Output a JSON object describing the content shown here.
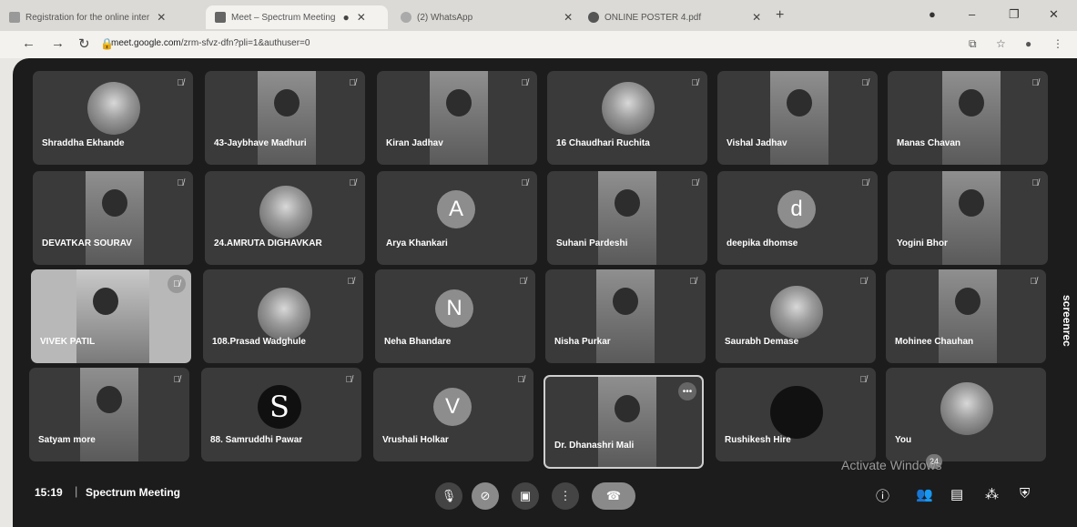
{
  "browser": {
    "tabs": [
      {
        "title": "Registration for the online inter",
        "active": false
      },
      {
        "title": "Meet – Spectrum Meeting",
        "active": true
      },
      {
        "title": "(2) WhatsApp",
        "active": false
      },
      {
        "title": "ONLINE POSTER 4.pdf",
        "active": false
      }
    ],
    "url_host": "meet.google.com",
    "url_path": "/zrm-sfvz-dfn?pli=1&authuser=0"
  },
  "participants": [
    {
      "name": "Shraddha Ekhande",
      "style": "avatar-pic"
    },
    {
      "name": "43-Jaybhave Madhuri",
      "style": "photo"
    },
    {
      "name": "Kiran Jadhav",
      "style": "photo"
    },
    {
      "name": "16 Chaudhari Ruchita",
      "style": "avatar-pic"
    },
    {
      "name": "Vishal Jadhav",
      "style": "photo"
    },
    {
      "name": "Manas Chavan",
      "style": "photo"
    },
    {
      "name": "DEVATKAR SOURAV",
      "style": "photo"
    },
    {
      "name": "24.AMRUTA DIGHAVKAR",
      "style": "avatar-pic"
    },
    {
      "name": "Arya Khankari",
      "style": "letter",
      "letter": "A"
    },
    {
      "name": "Suhani Pardeshi",
      "style": "photo"
    },
    {
      "name": "deepika dhomse",
      "style": "letter",
      "letter": "d"
    },
    {
      "name": "Yogini Bhor",
      "style": "photo"
    },
    {
      "name": "VIVEK PATIL",
      "style": "light"
    },
    {
      "name": "108.Prasad Wadghule",
      "style": "avatar-pic"
    },
    {
      "name": "Neha Bhandare",
      "style": "letter",
      "letter": "N"
    },
    {
      "name": "Nisha Purkar",
      "style": "photo"
    },
    {
      "name": "Saurabh Demase",
      "style": "avatar-pic"
    },
    {
      "name": "Mohinee Chauhan",
      "style": "photo"
    },
    {
      "name": "Satyam more",
      "style": "photo"
    },
    {
      "name": "88. Samruddhi Pawar",
      "style": "sletter",
      "letter": "S"
    },
    {
      "name": "Vrushali Holkar",
      "style": "letter",
      "letter": "V"
    },
    {
      "name": "Dr. Dhanashri Mali",
      "style": "photo-active"
    },
    {
      "name": "Rushikesh Hire",
      "style": "avatar-dark"
    },
    {
      "name": "You",
      "style": "avatar-pic"
    }
  ],
  "side_label": "screenrec",
  "bottom": {
    "time": "15:19",
    "separator": "|",
    "meeting_name": "Spectrum Meeting",
    "people_count": "24"
  },
  "watermark": "Activate Windows"
}
